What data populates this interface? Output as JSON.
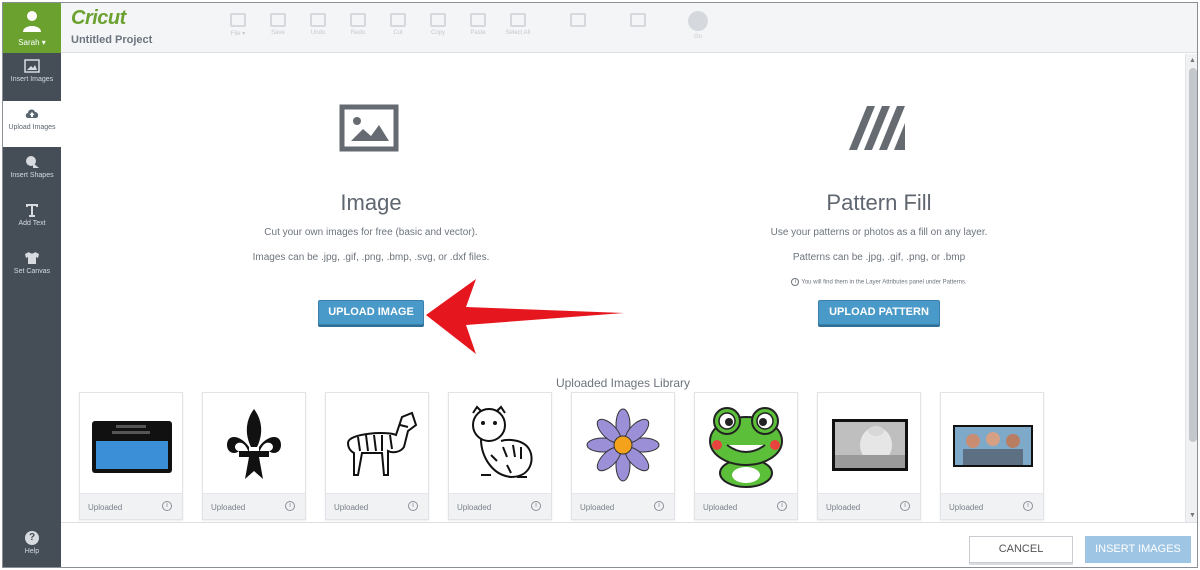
{
  "sidebar": {
    "user_name": "Sarah ▾",
    "items": [
      {
        "label": "Insert Images",
        "icon": "image-icon",
        "active": false
      },
      {
        "label": "Upload Images",
        "icon": "cloud-upload-icon",
        "active": true
      },
      {
        "label": "Insert Shapes",
        "icon": "shapes-icon",
        "active": false
      },
      {
        "label": "Add Text",
        "icon": "text-icon",
        "active": false
      },
      {
        "label": "Set Canvas",
        "icon": "shirt-icon",
        "active": false
      }
    ],
    "help_label": "Help"
  },
  "header": {
    "logo": "Cricut",
    "project_title": "Untitled Project",
    "toolbar": [
      "File ▾",
      "Save",
      "Undo",
      "Redo",
      "Cut",
      "Copy",
      "Paste",
      "Select All",
      "",
      "",
      "Go"
    ]
  },
  "image_panel": {
    "title": "Image",
    "desc1": "Cut your own images for free (basic and vector).",
    "desc2": "Images can be .jpg, .gif, .png, .bmp, .svg, or .dxf files.",
    "button": "UPLOAD IMAGE"
  },
  "pattern_panel": {
    "title": "Pattern Fill",
    "desc1": "Use your patterns or photos as a fill on any layer.",
    "desc2": "Patterns can be .jpg, .gif, .png, or .bmp",
    "note": "You will find them in the Layer Attributes panel under Patterns.",
    "button": "UPLOAD PATTERN"
  },
  "library": {
    "title": "Uploaded Images Library",
    "items": [
      {
        "label": "Uploaded",
        "thumb": "blue-card-image"
      },
      {
        "label": "Uploaded",
        "thumb": "fleur-de-lis-image"
      },
      {
        "label": "Uploaded",
        "thumb": "zebra-image"
      },
      {
        "label": "Uploaded",
        "thumb": "tiger-image"
      },
      {
        "label": "Uploaded",
        "thumb": "daisy-image"
      },
      {
        "label": "Uploaded",
        "thumb": "frog-image"
      },
      {
        "label": "Uploaded",
        "thumb": "baby-photo-image"
      },
      {
        "label": "Uploaded",
        "thumb": "group-photo-image"
      }
    ]
  },
  "footer": {
    "cancel": "CANCEL",
    "insert": "INSERT IMAGES"
  },
  "colors": {
    "brand_green": "#6aa12f",
    "sidebar": "#454d57",
    "primary_button": "#4a9ac9",
    "insert_disabled": "#9ec5e3",
    "annotation_arrow": "#e5161d"
  }
}
